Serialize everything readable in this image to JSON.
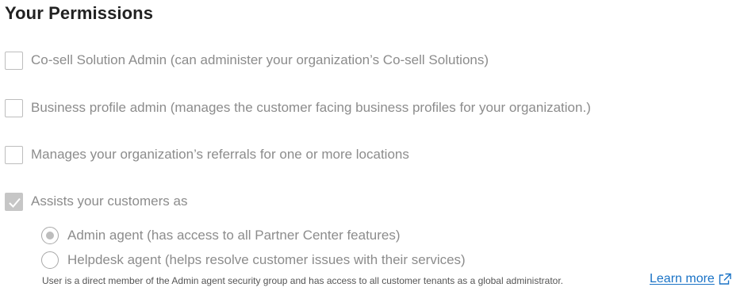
{
  "section": {
    "title": "Your Permissions"
  },
  "permissions": [
    {
      "label": "Co-sell Solution Admin (can administer your organization’s Co-sell Solutions)",
      "checked": false
    },
    {
      "label": "Business profile admin (manages the customer facing business profiles for your organization.)",
      "checked": false
    },
    {
      "label": "Manages your organization’s referrals for one or more locations",
      "checked": false
    },
    {
      "label": "Assists your customers as",
      "checked": true
    }
  ],
  "agent_options": [
    {
      "label": "Admin agent (has access to all Partner Center features)",
      "selected": true
    },
    {
      "label": "Helpdesk agent (helps resolve customer issues with their services)",
      "selected": false
    }
  ],
  "helper_text": "User is a direct member of the Admin agent security group and has access to all customer tenants as a global administrator.",
  "learn_more": {
    "label": "Learn more",
    "icon": "external-link-icon"
  },
  "colors": {
    "link": "#1a73c6",
    "disabled_text": "#8c8c8c",
    "checked_fill": "#c6c6c6"
  }
}
